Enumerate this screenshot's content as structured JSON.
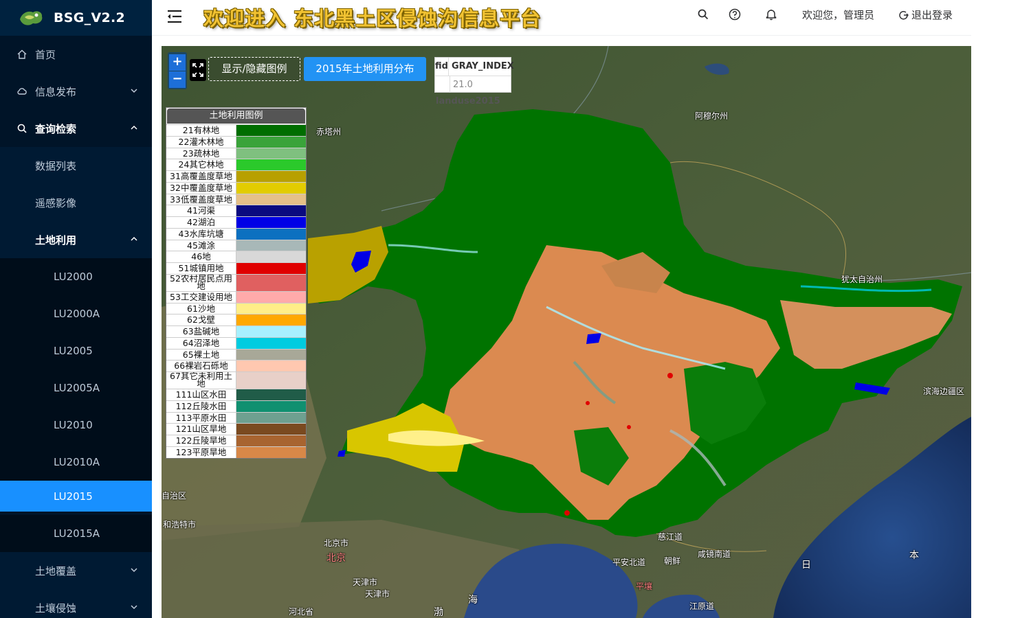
{
  "app": {
    "logo_text": "BSG_V2.2",
    "title": "欢迎进入 东北黑土区侵蚀沟信息平台"
  },
  "header": {
    "welcome": "欢迎您，管理员",
    "logout": "退出登录"
  },
  "sidebar": {
    "items": [
      {
        "label": "首页",
        "icon": "home-icon"
      },
      {
        "label": "信息发布",
        "icon": "cloud-icon"
      },
      {
        "label": "查询检索",
        "icon": "search-icon"
      },
      {
        "label": "数据列表"
      },
      {
        "label": "遥感影像"
      },
      {
        "label": "土地利用"
      },
      {
        "label": "LU2000"
      },
      {
        "label": "LU2000A"
      },
      {
        "label": "LU2005"
      },
      {
        "label": "LU2005A"
      },
      {
        "label": "LU2010"
      },
      {
        "label": "LU2010A"
      },
      {
        "label": "LU2015"
      },
      {
        "label": "LU2015A"
      },
      {
        "label": "土地覆盖"
      },
      {
        "label": "土壤侵蚀"
      }
    ]
  },
  "map": {
    "zoom_in": "+",
    "zoom_out": "−",
    "legend_toggle": "显示/隐藏图例",
    "layer_button": "2015年土地利用分布",
    "attr_table": {
      "col1": "fid",
      "col2": "GRAY_INDEX",
      "value1": "",
      "value2": "21.0"
    },
    "layer_name": "landuse2015",
    "place_labels": [
      "赤塔州",
      "阿穆尔州",
      "犹太自治州",
      "滨海边疆区",
      "自治区",
      "和浩特市",
      "北京市",
      "北京",
      "天津市",
      "天津市",
      "河北省",
      "慈江道",
      "咸镜南道",
      "平安北道",
      "朝鲜",
      "平壤",
      "江原道",
      "渤",
      "海",
      "日",
      "本"
    ],
    "accent_color": "#1890ff"
  },
  "legend": {
    "title": "土地利用图例",
    "items": [
      {
        "label": "21有林地",
        "color": "#006e00"
      },
      {
        "label": "22灌木林地",
        "color": "#3aa33a"
      },
      {
        "label": "23疏林地",
        "color": "#7fc07f"
      },
      {
        "label": "24其它林地",
        "color": "#2bc92b"
      },
      {
        "label": "31高覆盖度草地",
        "color": "#b8a000"
      },
      {
        "label": "32中覆盖度草地",
        "color": "#e2cc00"
      },
      {
        "label": "33低覆盖度草地",
        "color": "#e5c088"
      },
      {
        "label": "41河渠",
        "color": "#0a0a80"
      },
      {
        "label": "42湖泊",
        "color": "#0000e6"
      },
      {
        "label": "43水库坑塘",
        "color": "#0c70c0"
      },
      {
        "label": "45滩涂",
        "color": "#a8b8b8"
      },
      {
        "label": "46地",
        "color": "#d8d8d8"
      },
      {
        "label": "51城镇用地",
        "color": "#e00000"
      },
      {
        "label": "52农村居民点用地",
        "color": "#e06060"
      },
      {
        "label": "53工交建设用地",
        "color": "#ffaaaa"
      },
      {
        "label": "61沙地",
        "color": "#ffee88"
      },
      {
        "label": "62戈壁",
        "color": "#ffa800"
      },
      {
        "label": "63盐碱地",
        "color": "#a8f0ff"
      },
      {
        "label": "64沼泽地",
        "color": "#00cce0"
      },
      {
        "label": "65裸土地",
        "color": "#a8a898"
      },
      {
        "label": "66裸岩石砾地",
        "color": "#ffc8b0"
      },
      {
        "label": "67其它未利用土地",
        "color": "#e8d0c8"
      },
      {
        "label": "111山区水田",
        "color": "#205c48"
      },
      {
        "label": "112丘陵水田",
        "color": "#109070"
      },
      {
        "label": "113平原水田",
        "color": "#6ea090"
      },
      {
        "label": "121山区旱地",
        "color": "#7a4a20"
      },
      {
        "label": "122丘陵旱地",
        "color": "#a86430"
      },
      {
        "label": "123平原旱地",
        "color": "#d88848"
      }
    ]
  }
}
